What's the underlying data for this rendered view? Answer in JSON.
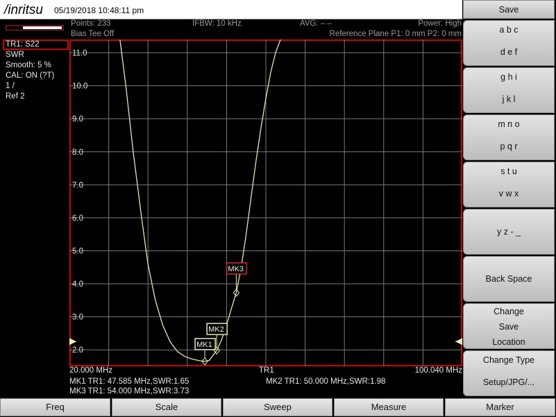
{
  "titlebar": {
    "logo": "/inritsu",
    "datetime": "05/19/2018 10:48:11 pm"
  },
  "header": {
    "points": "Points: 233",
    "bias_tee": "Bias Tee Off",
    "ifbw": "IFBW: 10 kHz",
    "avg": "AVG: – –",
    "power": "Power: High",
    "ref_plane": "Reference Plane P1: 0 mm P2: 0 mm"
  },
  "left_panel": {
    "trace": "TR1: S22",
    "format": "SWR",
    "smooth": "Smooth: 5 %",
    "cal": "CAL: ON (?T)",
    "scale": "1 /",
    "ref": "Ref 2"
  },
  "chart_data": {
    "type": "line",
    "x_start": "20.000 MHz",
    "x_stop": "100.040 MHz",
    "x_center_label": "TR1",
    "xlim": [
      20.0,
      100.04
    ],
    "ylim": [
      1.5,
      11.4
    ],
    "y_ticks": [
      "11.0",
      "10.0",
      "9.0",
      "8.0",
      "7.0",
      "6.0",
      "5.0",
      "4.0",
      "3.0",
      "2.0"
    ],
    "grid": true,
    "trace_color": "#e8e8a0",
    "series": [
      {
        "x": [
          30.3,
          31.5,
          33.0,
          34.7,
          36.0,
          37.5,
          39.0,
          40.5,
          42.0,
          43.5,
          45.0,
          46.5,
          47.585,
          48.5,
          50.0,
          51.0,
          52.0,
          53.0,
          54.0,
          55.0,
          56.0,
          57.0,
          58.0,
          59.0,
          60.0,
          61.0,
          62.0,
          63.0
        ],
        "y": [
          11.4,
          10.0,
          8.0,
          6.0,
          4.6,
          3.5,
          2.75,
          2.25,
          1.95,
          1.8,
          1.72,
          1.67,
          1.65,
          1.68,
          1.98,
          2.3,
          2.75,
          3.25,
          3.73,
          4.5,
          5.5,
          6.6,
          7.7,
          8.7,
          9.6,
          10.4,
          11.0,
          11.4
        ]
      }
    ],
    "markers": [
      {
        "label": "MK1",
        "x": 47.585,
        "y": 1.65
      },
      {
        "label": "MK2",
        "x": 50.0,
        "y": 1.98
      },
      {
        "label": "MK3",
        "x": 54.0,
        "y": 3.73
      }
    ],
    "reference_level": 2.0
  },
  "footer": {
    "start": "20.000 MHz",
    "center": "TR1",
    "stop": "100.040 MHz",
    "mk1": "MK1 TR1:  47.585 MHz,SWR:1.65",
    "mk2": "MK2 TR1:  50.000 MHz,SWR:1.98",
    "mk3": "MK3 TR1:  54.000 MHz,SWR:3.73"
  },
  "right_menu": {
    "save": "Save",
    "abc": "a b c",
    "def": "d e f",
    "ghi": "g h i",
    "jkl": "j k l",
    "mno": "m n o",
    "pqr": "p q r",
    "stu": "s t u",
    "vwx": "v w x",
    "yz": "y z - _",
    "backspace": "Back Space",
    "change_save_location": [
      "Change",
      "Save",
      "Location"
    ],
    "change_type": "Change Type",
    "setup_jpg": "Setup/JPG/..."
  },
  "bottom_menu": [
    "Freq",
    "Scale",
    "Sweep",
    "Measure",
    "Marker"
  ]
}
